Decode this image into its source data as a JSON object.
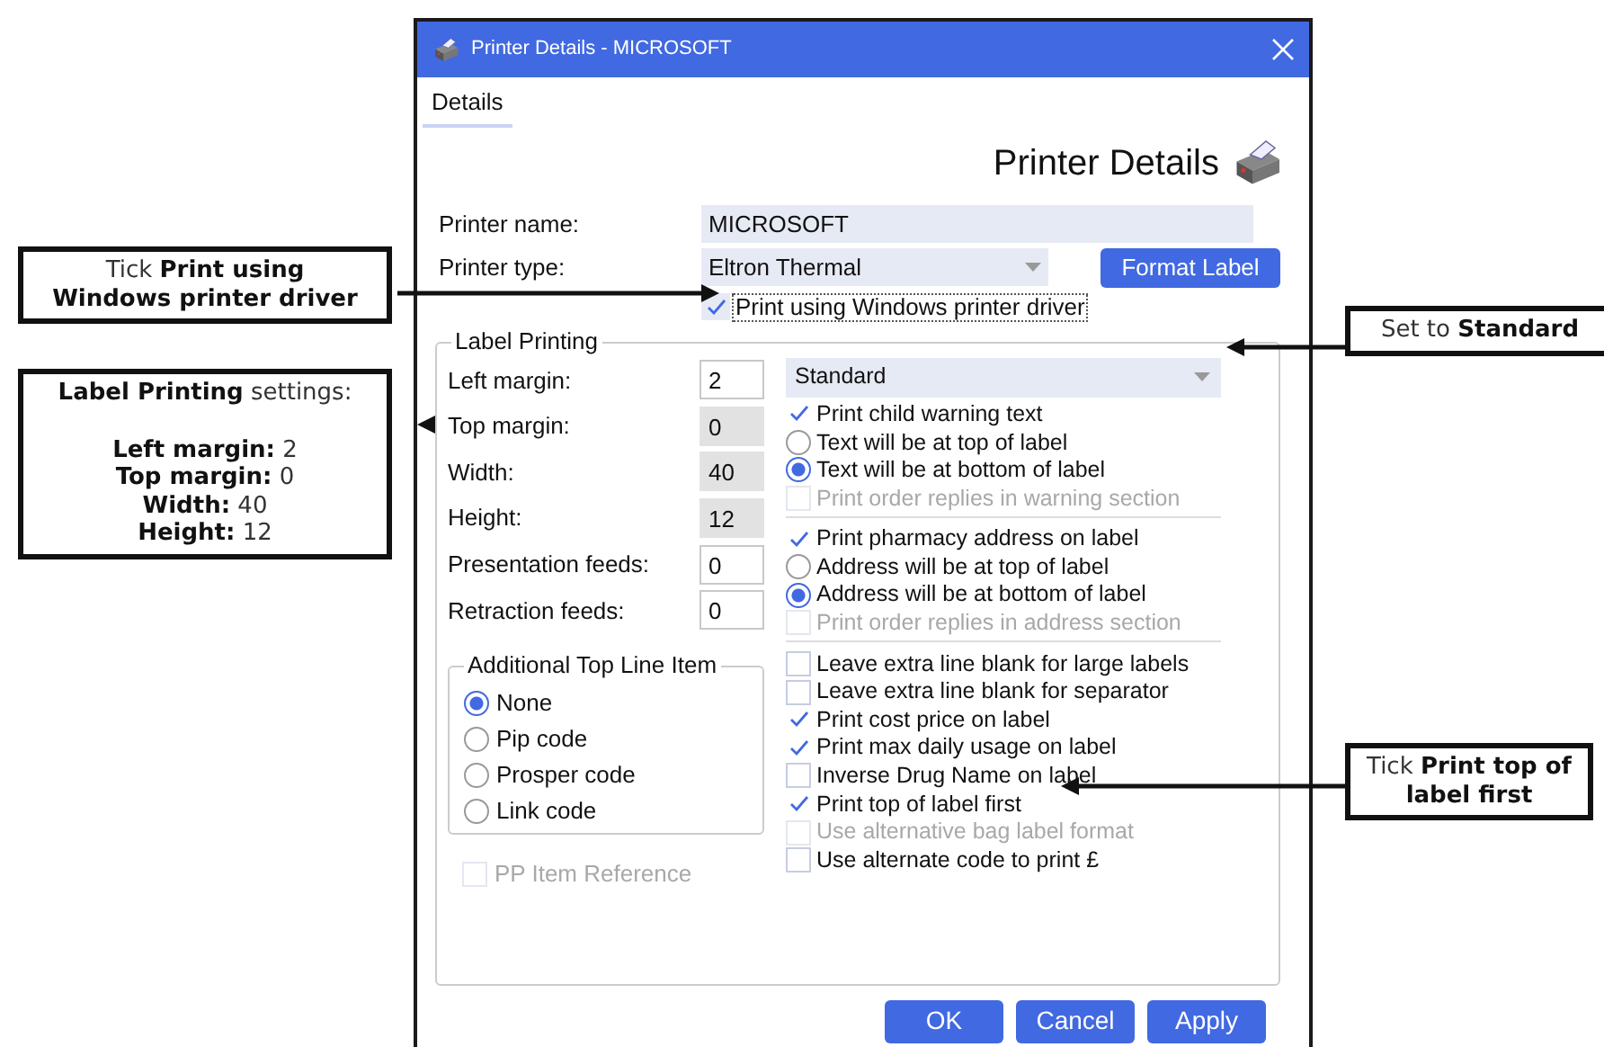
{
  "window": {
    "title": "Printer Details - MICROSOFT"
  },
  "menu": [
    {
      "label": "Details",
      "selected": true
    }
  ],
  "heading": "Printer Details",
  "printer_name": {
    "label": "Printer name:",
    "value": "MICROSOFT"
  },
  "printer_type": {
    "label": "Printer type:",
    "value": "Eltron Thermal",
    "button": "Format Label"
  },
  "windows_driver": {
    "label": "Print using Windows printer driver",
    "checked": true
  },
  "label_printing": {
    "title": "Label Printing",
    "fields": [
      {
        "label": "Left margin:",
        "value": "2",
        "disabled": false
      },
      {
        "label": "Top margin:",
        "value": "0",
        "disabled": true
      },
      {
        "label": "Width:",
        "value": "40",
        "disabled": true
      },
      {
        "label": "Height:",
        "value": "12",
        "disabled": true
      },
      {
        "label": "Presentation feeds:",
        "value": "0",
        "disabled": false
      },
      {
        "label": "Retraction feeds:",
        "value": "0",
        "disabled": false
      }
    ],
    "top_line": {
      "title": "Additional Top Line Item",
      "options": [
        {
          "label": "None",
          "selected": true
        },
        {
          "label": "Pip code",
          "selected": false
        },
        {
          "label": "Prosper code",
          "selected": false
        },
        {
          "label": "Link code",
          "selected": false
        }
      ]
    },
    "pp_item": {
      "label": "PP Item Reference",
      "checked": false,
      "disabled": true
    },
    "format": {
      "value": "Standard"
    },
    "options": [
      {
        "kind": "checkbox",
        "label": "Print child warning text",
        "checked": true,
        "disabled": false
      },
      {
        "kind": "radio",
        "label": "Text will be at top of label",
        "checked": false,
        "disabled": false
      },
      {
        "kind": "radio",
        "label": "Text will be at bottom of label",
        "checked": true,
        "disabled": false
      },
      {
        "kind": "checkbox",
        "label": "Print order replies in warning section",
        "checked": false,
        "disabled": true
      },
      {
        "kind": "separator"
      },
      {
        "kind": "checkbox",
        "label": "Print pharmacy address on label",
        "checked": true,
        "disabled": false
      },
      {
        "kind": "radio",
        "label": "Address will be at top of label",
        "checked": false,
        "disabled": false
      },
      {
        "kind": "radio",
        "label": "Address will be at bottom of label",
        "checked": true,
        "disabled": false
      },
      {
        "kind": "checkbox",
        "label": "Print order replies in address section",
        "checked": false,
        "disabled": true
      },
      {
        "kind": "separator"
      },
      {
        "kind": "checkbox",
        "label": "Leave extra line blank for large labels",
        "checked": false,
        "disabled": false
      },
      {
        "kind": "checkbox",
        "label": "Leave extra line blank for separator",
        "checked": false,
        "disabled": false
      },
      {
        "kind": "checkbox",
        "label": "Print cost price on label",
        "checked": true,
        "disabled": false
      },
      {
        "kind": "checkbox",
        "label": "Print max daily usage on label",
        "checked": true,
        "disabled": false
      },
      {
        "kind": "checkbox",
        "label": "Inverse Drug Name on label",
        "checked": false,
        "disabled": false
      },
      {
        "kind": "checkbox",
        "label": "Print top of label first",
        "checked": true,
        "disabled": false
      },
      {
        "kind": "checkbox",
        "label": "Use alternative bag label format",
        "checked": false,
        "disabled": true
      },
      {
        "kind": "checkbox",
        "label": "Use alternate code to print £",
        "checked": false,
        "disabled": false
      }
    ]
  },
  "buttons": [
    "OK",
    "Cancel",
    "Apply"
  ],
  "callouts": [
    {
      "lines": [
        "Tick **Print using**",
        "**Windows printer driver**"
      ]
    },
    {
      "title": "**Label Printing** settings:",
      "lines": [
        "**Left margin:** 2",
        "**Top margin:** 0",
        "**Width:** 40",
        "**Height:** 12"
      ]
    },
    {
      "lines": [
        "Set to **Standard**"
      ]
    },
    {
      "lines": [
        "Tick **Print top of**",
        "**label first**"
      ]
    }
  ]
}
